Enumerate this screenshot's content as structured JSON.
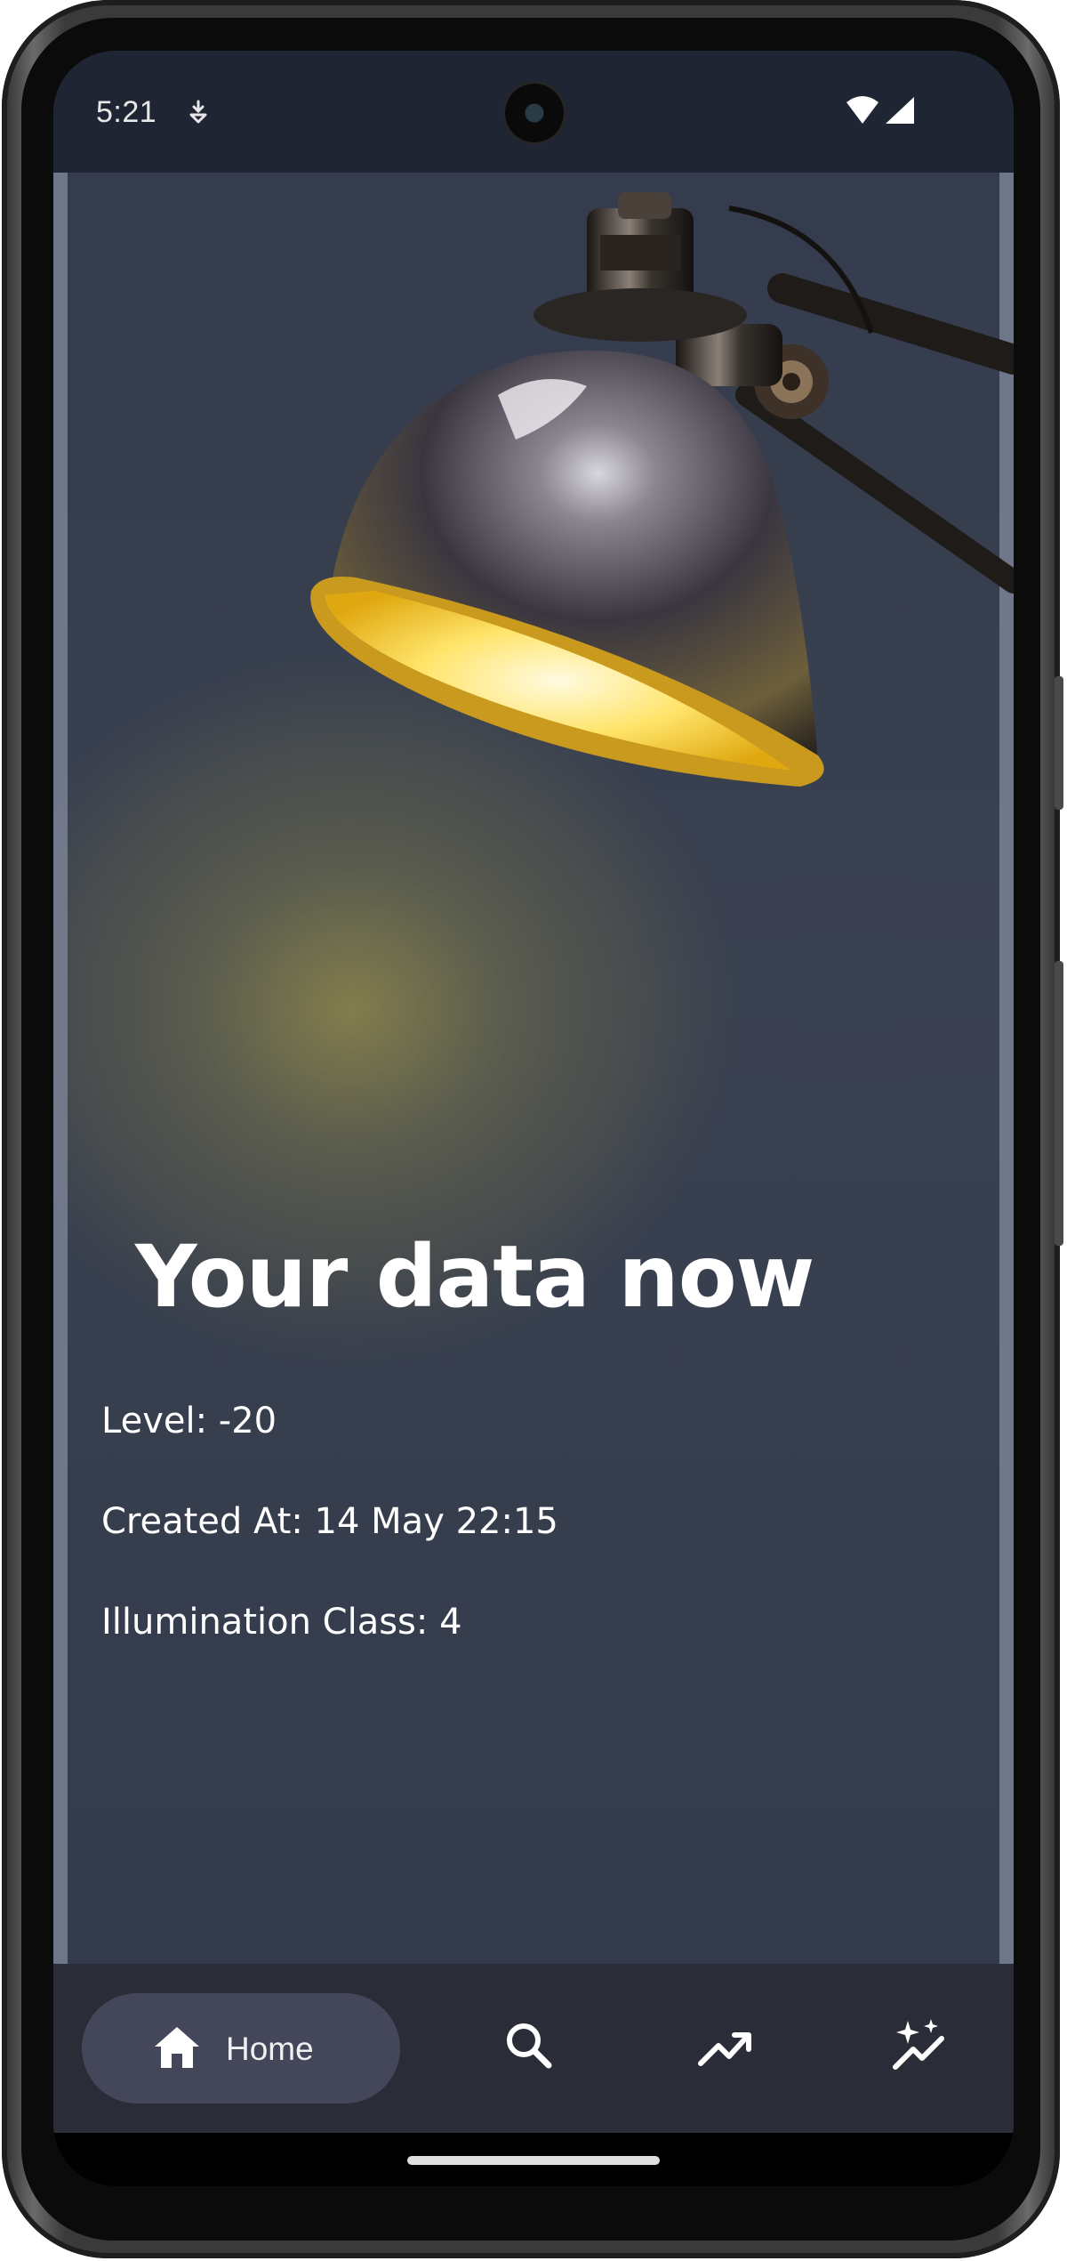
{
  "status_bar": {
    "time": "5:21",
    "notification_icon": "download-notification-icon",
    "wifi_icon": "wifi-icon",
    "signal_icon": "cell-signal-icon"
  },
  "hero": {
    "image": "desk-lamp-illustration"
  },
  "main": {
    "title": "Your data now",
    "level": "Level: -20",
    "created_at": "Created At: 14 May 22:15",
    "illumination_class": "Illumination Class: 4"
  },
  "nav": {
    "items": [
      {
        "label": "Home",
        "icon": "home-icon",
        "selected": true
      },
      {
        "label": "",
        "icon": "search-icon",
        "selected": false
      },
      {
        "label": "",
        "icon": "trending-up-icon",
        "selected": false
      },
      {
        "label": "",
        "icon": "sparkle-chart-icon",
        "selected": false
      }
    ]
  },
  "colors": {
    "background": "#343c4d",
    "navbar": "#2a2c37",
    "selected_pill": "#44475a",
    "lamp_glow": "#f5c518",
    "text": "#ffffff"
  }
}
